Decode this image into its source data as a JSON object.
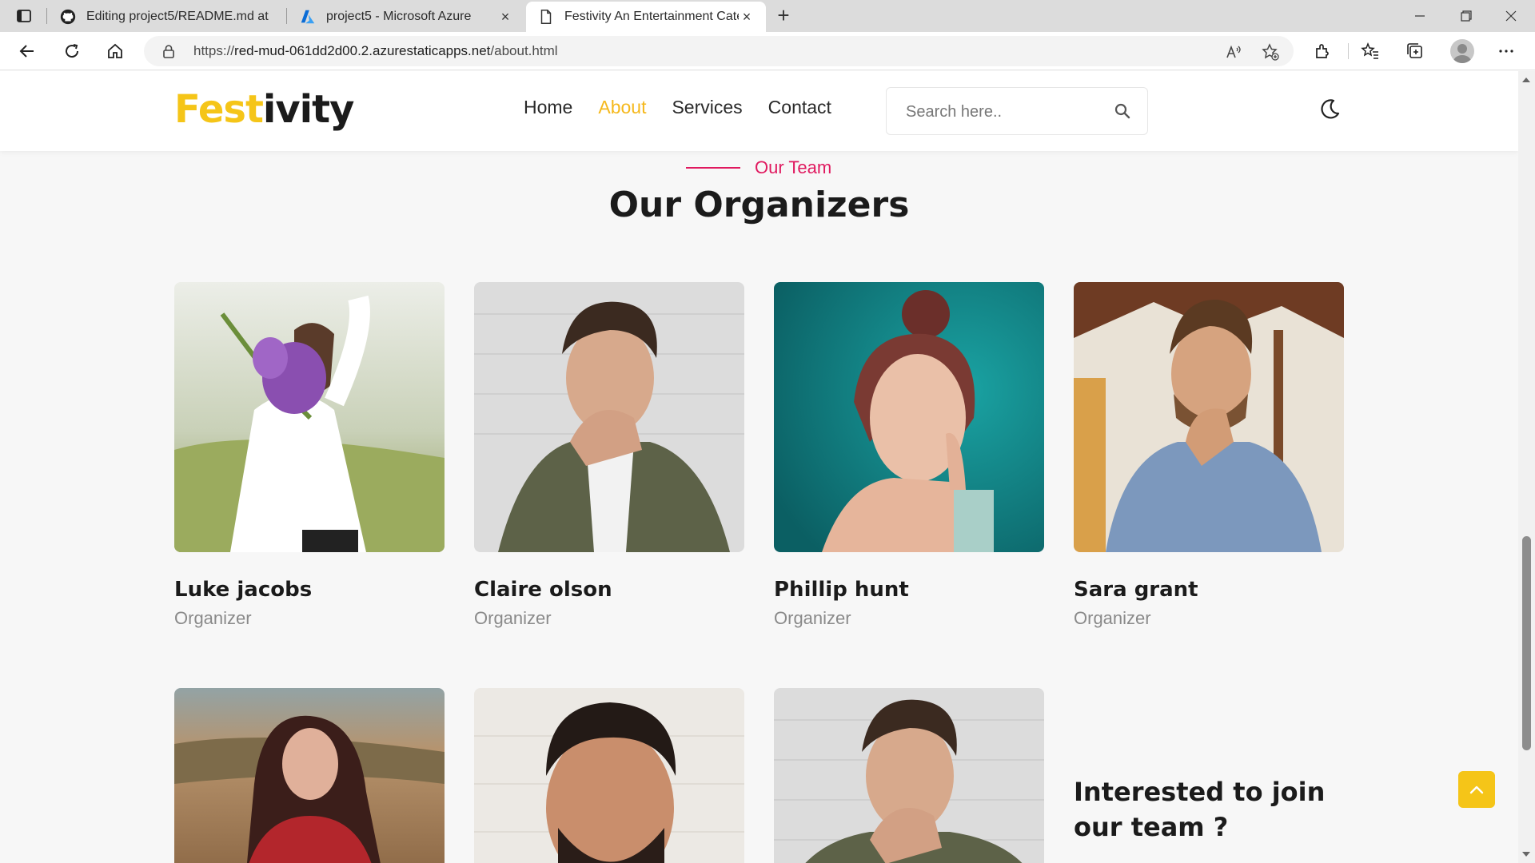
{
  "browser": {
    "tabs": [
      {
        "title": "Editing project5/README.md at",
        "icon": "github-icon"
      },
      {
        "title": "project5 - Microsoft Azure",
        "icon": "azure-icon"
      },
      {
        "title": "Festivity An Entertainment Categ",
        "icon": "page-icon",
        "active": true
      }
    ],
    "url": {
      "prefix": "https://",
      "domain": "red-mud-061dd2d00.2.azurestaticapps.net",
      "path": "/about.html"
    }
  },
  "site": {
    "logo_accent": "Fest",
    "logo_rest": "ivity",
    "nav": [
      {
        "label": "Home"
      },
      {
        "label": "About",
        "active": true
      },
      {
        "label": "Services"
      },
      {
        "label": "Contact"
      }
    ],
    "search_placeholder": "Search here..",
    "colors": {
      "accent": "#f5c518",
      "kicker": "#e0195f"
    }
  },
  "section": {
    "kicker": "Our Team",
    "title": "Our Organizers"
  },
  "team": [
    {
      "name": "Luke jacobs",
      "role": "Organizer"
    },
    {
      "name": "Claire olson",
      "role": "Organizer"
    },
    {
      "name": "Phillip hunt",
      "role": "Organizer"
    },
    {
      "name": "Sara grant",
      "role": "Organizer"
    }
  ],
  "join": {
    "title": "Interested to join our team ?"
  }
}
